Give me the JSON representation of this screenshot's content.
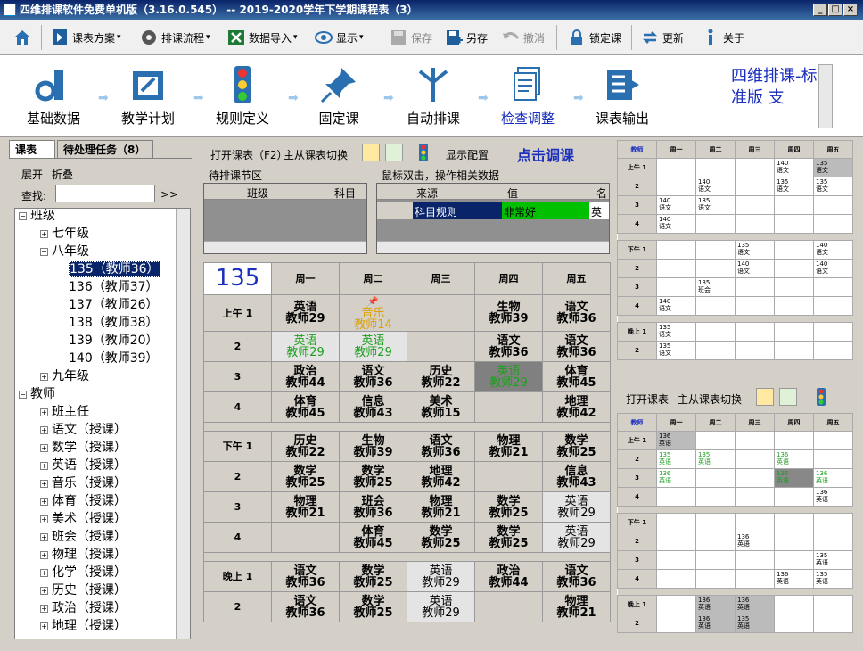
{
  "window": {
    "title": "四维排课软件免费单机版（3.16.0.545） -- 2019-2020学年下学期课程表（3）",
    "min": "_",
    "max": "□",
    "close": "×"
  },
  "toolbar": {
    "scheme": "课表方案",
    "flow": "排课流程",
    "import": "数据导入",
    "display": "显示",
    "save": "保存",
    "save_as": "另存",
    "undo": "撤消",
    "lock": "锁定课",
    "update": "更新",
    "about": "关于",
    "dropdown": "▾"
  },
  "workflow": {
    "steps": [
      "基础数据",
      "教学计划",
      "规则定义",
      "固定课",
      "自动排课",
      "检查调整",
      "课表输出"
    ],
    "arrow": "➡",
    "brand": "四维排课-标准版 支"
  },
  "left": {
    "tab1": "课表",
    "tab2": "待处理任务（8）",
    "expand": "展开",
    "collapse": "折叠",
    "find_label": "查找:",
    "find_go": ">>",
    "tree": [
      "班级",
      "七年级",
      "八年级",
      "135（教师36）",
      "136（教师37）",
      "137（教师26）",
      "138（教师38）",
      "139（教师20）",
      "140（教师39）",
      "九年级",
      "教师",
      "班主任",
      "语文（授课）",
      "数学（授课）",
      "英语（授课）",
      "音乐（授课）",
      "体育（授课）",
      "美术（授课）",
      "班会（授课）",
      "物理（授课）",
      "化学（授课）",
      "历史（授课）",
      "政治（授课）",
      "地理（授课）"
    ]
  },
  "center": {
    "open": "打开课表（F2）",
    "switch": "主从课表切换",
    "show_cfg": "显示配置",
    "click_adjust": "点击调课",
    "pending_title": "待排课节区",
    "pending_cols": [
      "班级",
      "科目"
    ],
    "mouse_title": "鼠标双击，操作相关数据",
    "mouse_cols": [
      "来源",
      "值",
      "名"
    ],
    "mouse_row": [
      "科目规则",
      "非常好",
      "英语"
    ],
    "class_no": "135",
    "days": [
      "周一",
      "周二",
      "周三",
      "周四",
      "周五"
    ],
    "am": "上午 1",
    "pm": "下午 1",
    "ev": "晚上 1",
    "nums": [
      "2",
      "3",
      "4"
    ],
    "rows": [
      [
        "英语|教师29",
        "音乐|教师14",
        "",
        "生物|教师39",
        "语文|教师36"
      ],
      [
        "英语|教师29",
        "英语|教师29",
        "",
        "语文|教师36",
        "语文|教师36"
      ],
      [
        "政治|教师44",
        "语文|教师36",
        "历史|教师22",
        "英语|教师29",
        "体育|教师45"
      ],
      [
        "体育|教师45",
        "信息|教师43",
        "美术|教师15",
        "",
        "地理|教师42"
      ],
      [
        "历史|教师22",
        "生物|教师39",
        "语文|教师36",
        "物理|教师21",
        "数学|教师25"
      ],
      [
        "数学|教师25",
        "数学|教师25",
        "地理|教师42",
        "",
        "信息|教师43"
      ],
      [
        "物理|教师21",
        "班会|教师36",
        "物理|教师21",
        "数学|教师25",
        "英语|教师29"
      ],
      [
        "",
        "体育|教师45",
        "数学|教师25",
        "数学|教师25",
        "英语|教师29"
      ],
      [
        "语文|教师36",
        "数学|教师25",
        "英语|教师29",
        "政治|教师44",
        "语文|教师36"
      ],
      [
        "语文|教师36",
        "数学|教师25",
        "英语|教师29",
        "",
        "物理|教师21"
      ]
    ]
  },
  "right": {
    "teacher": "教师",
    "days": [
      "周一",
      "周二",
      "周三",
      "周四",
      "周五"
    ],
    "am": "上午 1",
    "pm": "下午 1",
    "ev": "晚上 1",
    "nums": [
      "2",
      "3",
      "4"
    ],
    "open": "打开课表",
    "switch": "主从课表切换",
    "top": [
      [
        "",
        "",
        "",
        "140|语文",
        "135|语文"
      ],
      [
        "",
        "140|语文",
        "",
        "135|语文",
        "135|语文"
      ],
      [
        "140|语文",
        "135|语文",
        "",
        "",
        ""
      ],
      [
        "140|语文",
        "",
        "",
        "",
        ""
      ],
      [
        "",
        "",
        "135|语文",
        "",
        "140|语文"
      ],
      [
        "",
        "",
        "140|语文",
        "",
        "140|语文"
      ],
      [
        "",
        "135|班会",
        "",
        "",
        ""
      ],
      [
        "140|语文",
        "",
        "",
        "",
        ""
      ],
      [
        "135|语文",
        "",
        "",
        "",
        ""
      ],
      [
        "135|语文",
        "",
        "",
        "",
        ""
      ]
    ],
    "bottom": [
      [
        "136|英语",
        "",
        "",
        "",
        ""
      ],
      [
        "135|英语",
        "135|英语",
        "",
        "136|英语",
        ""
      ],
      [
        "136|英语",
        "",
        "",
        "135|英语",
        "136|英语"
      ],
      [
        "",
        "",
        "",
        "",
        "136|英语"
      ],
      [
        "",
        "",
        "",
        "",
        ""
      ],
      [
        "",
        "",
        "136|英语",
        "",
        ""
      ],
      [
        "",
        "",
        "",
        "",
        "135|英语"
      ],
      [
        "",
        "",
        "",
        "136|英语",
        "135|英语"
      ],
      [
        "",
        "136|英语",
        "136|英语",
        "",
        ""
      ],
      [
        "",
        "136|英语",
        "135|英语",
        "",
        ""
      ]
    ]
  }
}
